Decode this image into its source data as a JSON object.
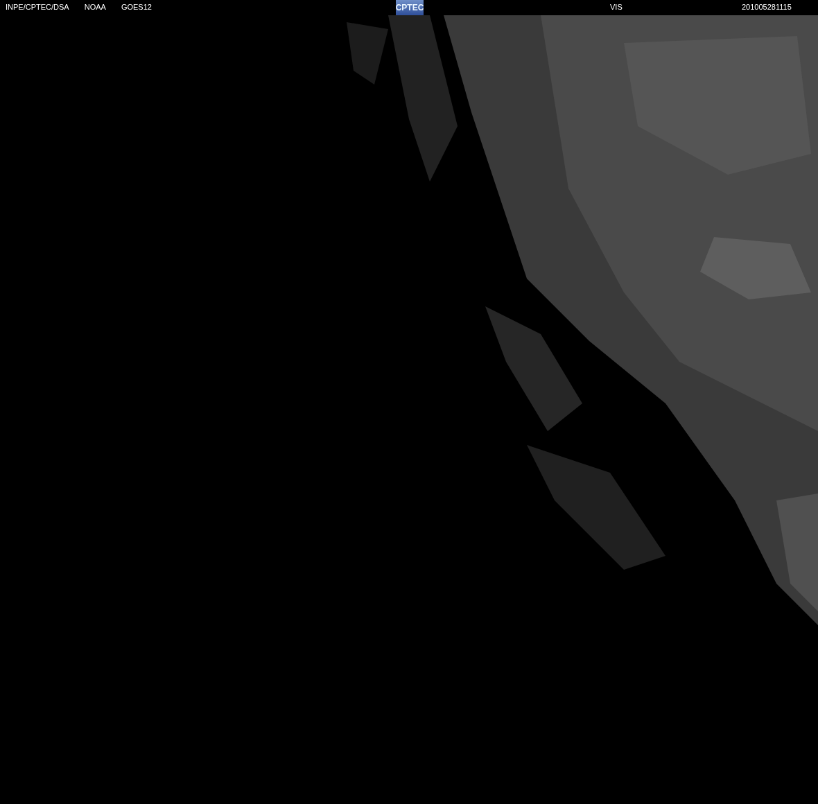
{
  "header": {
    "left_labels": [
      "INPE/CPTEC/DSA",
      "NOAA",
      "GOES12"
    ],
    "logo": "CPTEC",
    "channel": "VIS",
    "timestamp": "201005281115"
  }
}
